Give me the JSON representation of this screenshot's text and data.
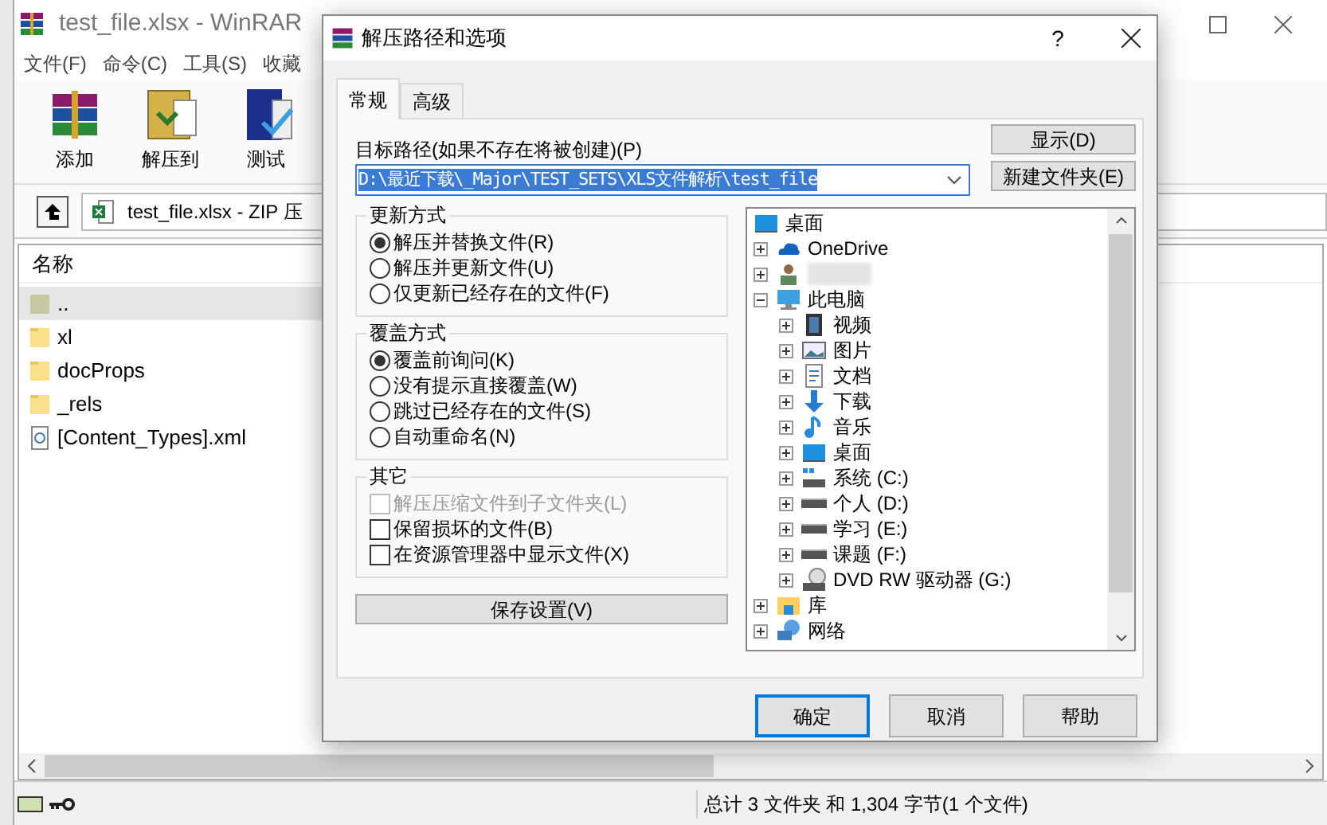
{
  "main_window": {
    "title": "test_file.xlsx - WinRAR",
    "menu": [
      "文件(F)",
      "命令(C)",
      "工具(S)",
      "收藏"
    ],
    "toolbar": [
      {
        "label": "添加",
        "kind": "add"
      },
      {
        "label": "解压到",
        "kind": "extract"
      },
      {
        "label": "测试",
        "kind": "test"
      }
    ],
    "address": "test_file.xlsx - ZIP 压",
    "column_header": "名称",
    "files": [
      {
        "name": "..",
        "kind": "up",
        "selected": true
      },
      {
        "name": "xl",
        "kind": "folder",
        "selected": false
      },
      {
        "name": "docProps",
        "kind": "folder",
        "selected": false
      },
      {
        "name": "_rels",
        "kind": "folder",
        "selected": false
      },
      {
        "name": "[Content_Types].xml",
        "kind": "xml",
        "selected": false
      }
    ],
    "status_bar": "总计 3 文件夹 和 1,304 字节(1 个文件)"
  },
  "dialog": {
    "title": "解压路径和选项",
    "help_button": "?",
    "tabs": [
      {
        "label": "常规",
        "selected": true
      },
      {
        "label": "高级",
        "selected": false
      }
    ],
    "path_label": "目标路径(如果不存在将被创建)(P)",
    "path_value": "D:\\最近下载\\_Major\\TEST_SETS\\XLS文件解析\\test_file",
    "path_selected": true,
    "side_buttons": [
      "显示(D)",
      "新建文件夹(E)"
    ],
    "groups": [
      {
        "title": "更新方式",
        "kind": "radio",
        "options": [
          {
            "label": "解压并替换文件(R)",
            "selected": true
          },
          {
            "label": "解压并更新文件(U)",
            "selected": false
          },
          {
            "label": "仅更新已经存在的文件(F)",
            "selected": false
          }
        ]
      },
      {
        "title": "覆盖方式",
        "kind": "radio",
        "options": [
          {
            "label": "覆盖前询问(K)",
            "selected": true
          },
          {
            "label": "没有提示直接覆盖(W)",
            "selected": false
          },
          {
            "label": "跳过已经存在的文件(S)",
            "selected": false
          },
          {
            "label": "自动重命名(N)",
            "selected": false
          }
        ]
      },
      {
        "title": "其它",
        "kind": "checkbox",
        "options": [
          {
            "label": "解压压缩文件到子文件夹(L)",
            "checked": false,
            "disabled": true
          },
          {
            "label": "保留损坏的文件(B)",
            "checked": false,
            "disabled": false
          },
          {
            "label": "在资源管理器中显示文件(X)",
            "checked": false,
            "disabled": false
          }
        ]
      }
    ],
    "save_button": "保存设置(V)",
    "tree": [
      {
        "label": "桌面",
        "kind": "desktop",
        "children": [
          {
            "label": "OneDrive",
            "kind": "cloud",
            "expanded": false
          },
          {
            "kind": "user",
            "expanded": false
          },
          {
            "label": "此电脑",
            "kind": "pc",
            "expanded": true,
            "children": [
              {
                "label": "视频",
                "kind": "video",
                "expanded": false
              },
              {
                "label": "图片",
                "kind": "picture",
                "expanded": false
              },
              {
                "label": "文档",
                "kind": "document",
                "expanded": false
              },
              {
                "label": "下载",
                "kind": "download",
                "expanded": false
              },
              {
                "label": "音乐",
                "kind": "music",
                "expanded": false
              },
              {
                "label": "桌面",
                "kind": "desktop",
                "expanded": false
              },
              {
                "label": "系统 (C:)",
                "kind": "system-drive",
                "expanded": false
              },
              {
                "label": "个人 (D:)",
                "kind": "drive",
                "expanded": false
              },
              {
                "label": "学习 (E:)",
                "kind": "drive",
                "expanded": false
              },
              {
                "label": "课题 (F:)",
                "kind": "drive",
                "expanded": false
              },
              {
                "label": "DVD RW 驱动器 (G:)",
                "kind": "dvd",
                "expanded": false
              }
            ]
          },
          {
            "label": "库",
            "kind": "library",
            "expanded": false
          },
          {
            "label": "网络",
            "kind": "network",
            "expanded": false
          }
        ]
      }
    ],
    "buttons": [
      {
        "label": "确定",
        "default": true
      },
      {
        "label": "取消",
        "default": false
      },
      {
        "label": "帮助",
        "default": false
      }
    ]
  }
}
